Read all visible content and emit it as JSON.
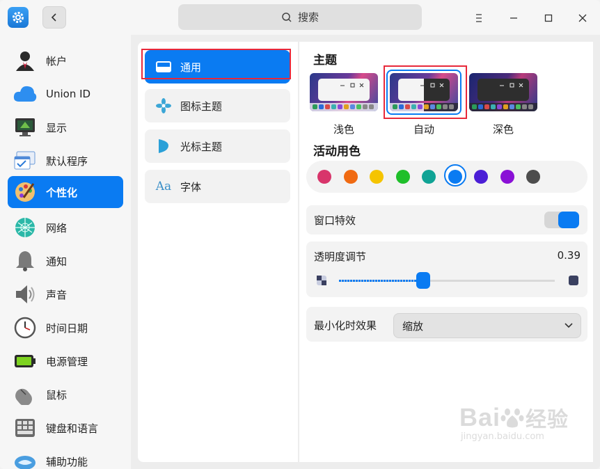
{
  "titlebar": {
    "search_placeholder": "搜索",
    "icons": [
      "settings-app-icon",
      "back-icon",
      "search-icon",
      "menu-icon",
      "minimize-icon",
      "maximize-icon",
      "close-icon"
    ]
  },
  "sidebar": {
    "items": [
      {
        "label": "帐户",
        "icon": "account-icon"
      },
      {
        "label": "Union ID",
        "icon": "cloud-icon"
      },
      {
        "label": "显示",
        "icon": "display-icon"
      },
      {
        "label": "默认程序",
        "icon": "default-apps-icon"
      },
      {
        "label": "个性化",
        "icon": "personalization-icon",
        "active": true
      },
      {
        "label": "网络",
        "icon": "network-icon"
      },
      {
        "label": "通知",
        "icon": "bell-icon"
      },
      {
        "label": "声音",
        "icon": "speaker-icon"
      },
      {
        "label": "时间日期",
        "icon": "clock-icon"
      },
      {
        "label": "电源管理",
        "icon": "battery-icon"
      },
      {
        "label": "鼠标",
        "icon": "mouse-icon"
      },
      {
        "label": "键盘和语言",
        "icon": "keyboard-icon"
      },
      {
        "label": "辅助功能",
        "icon": "accessibility-icon"
      }
    ]
  },
  "middle": {
    "items": [
      {
        "label": "通用",
        "icon": "window-icon",
        "active": true
      },
      {
        "label": "图标主题",
        "icon": "flower-icon"
      },
      {
        "label": "光标主题",
        "icon": "cursor-icon"
      },
      {
        "label": "字体",
        "icon": "font-icon",
        "glyph": "Aa"
      }
    ]
  },
  "main": {
    "theme_title": "主题",
    "themes": [
      {
        "label": "浅色",
        "selected": false
      },
      {
        "label": "自动",
        "selected": true
      },
      {
        "label": "深色",
        "selected": false
      }
    ],
    "accent_title": "活动用色",
    "accent_colors": [
      "#d8356b",
      "#f06a12",
      "#f5c400",
      "#1fbf2a",
      "#10a395",
      "#0a7bf2",
      "#4b1ed6",
      "#8a10d6",
      "#4d4d4d"
    ],
    "accent_selected_index": 5,
    "window_effects": {
      "label": "窗口特效",
      "enabled": true
    },
    "transparency": {
      "label": "透明度调节",
      "value": "0.39",
      "fraction": 0.39
    },
    "minimize_effect": {
      "label": "最小化时效果",
      "value": "缩放"
    }
  },
  "watermark": {
    "brand": "Bai",
    "brand2": "经验",
    "url": "jingyan.baidu.com"
  }
}
